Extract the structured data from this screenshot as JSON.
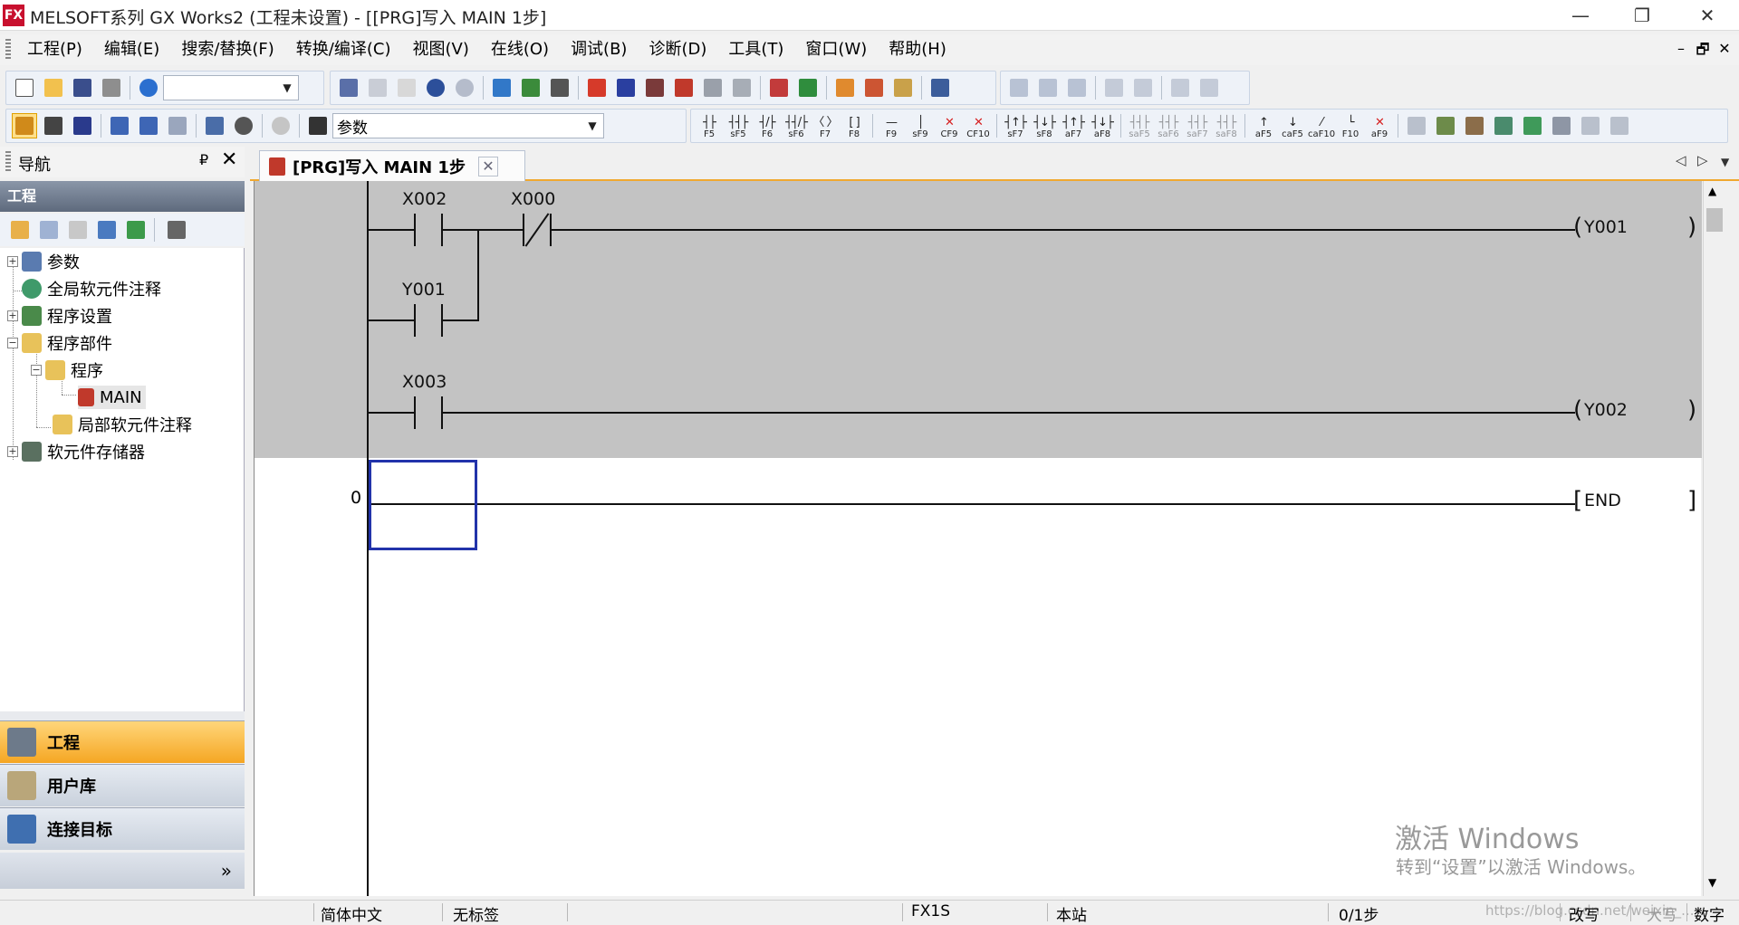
{
  "window": {
    "title": "MELSOFT系列 GX Works2 (工程未设置) - [[PRG]写入 MAIN 1步]",
    "app_icon_text": "FX",
    "controls": {
      "minimize": "—",
      "restore": "❐",
      "close": "✕"
    }
  },
  "menu": {
    "items": [
      "工程(P)",
      "编辑(E)",
      "搜索/替换(F)",
      "转换/编译(C)",
      "视图(V)",
      "在线(O)",
      "调试(B)",
      "诊断(D)",
      "工具(T)",
      "窗口(W)",
      "帮助(H)"
    ],
    "mdi_controls": {
      "minimize": "–",
      "restore": "🗗",
      "close": "✕"
    }
  },
  "toolbar": {
    "device_combo_value": "",
    "param_combo_value": "参数",
    "fkeys": [
      {
        "sym": "┤├",
        "label": "F5"
      },
      {
        "sym": "┤┤├",
        "label": "sF5"
      },
      {
        "sym": "┤/├",
        "label": "F6"
      },
      {
        "sym": "┤┤/├",
        "label": "sF6"
      },
      {
        "sym": "〈 〉",
        "label": "F7"
      },
      {
        "sym": "[ ]",
        "label": "F8"
      },
      {
        "sym": "—",
        "label": "F9"
      },
      {
        "sym": "│",
        "label": "sF9"
      },
      {
        "sym": "✕",
        "label": "CF9"
      },
      {
        "sym": "✕",
        "label": "CF10"
      },
      {
        "sym": "┤↑├",
        "label": "sF7"
      },
      {
        "sym": "┤↓├",
        "label": "sF8"
      },
      {
        "sym": "┤↑├",
        "label": "aF7"
      },
      {
        "sym": "┤↓├",
        "label": "aF8"
      },
      {
        "sym": "┤┤├",
        "label": "saF5"
      },
      {
        "sym": "┤┤├",
        "label": "saF6"
      },
      {
        "sym": "┤┤├",
        "label": "saF7"
      },
      {
        "sym": "┤┤├",
        "label": "saF8"
      },
      {
        "sym": "↑",
        "label": "aF5"
      },
      {
        "sym": "↓",
        "label": "caF5"
      },
      {
        "sym": "⁄",
        "label": "caF10"
      },
      {
        "sym": "└",
        "label": "F10"
      },
      {
        "sym": "✕",
        "label": "aF9"
      }
    ]
  },
  "nav": {
    "title": "导航",
    "pin": "₽",
    "close": "✕",
    "section": "工程",
    "tree": [
      {
        "label": "参数",
        "depth": 0,
        "expander": "+"
      },
      {
        "label": "全局软元件注释",
        "depth": 0,
        "expander": ""
      },
      {
        "label": "程序设置",
        "depth": 0,
        "expander": "+"
      },
      {
        "label": "程序部件",
        "depth": 0,
        "expander": "−"
      },
      {
        "label": "程序",
        "depth": 1,
        "expander": "−"
      },
      {
        "label": "MAIN",
        "depth": 2,
        "expander": ""
      },
      {
        "label": "局部软元件注释",
        "depth": 1,
        "expander": ""
      },
      {
        "label": "软元件存储器",
        "depth": 0,
        "expander": "+"
      }
    ],
    "bottom_buttons": [
      "工程",
      "用户库",
      "连接目标"
    ],
    "more": "»"
  },
  "editor": {
    "tab_label": "[PRG]写入 MAIN 1步",
    "tab_close": "✕",
    "tab_nav": {
      "prev": "◁",
      "next": "▷",
      "menu": "▼"
    },
    "ladder": {
      "contacts": [
        {
          "device": "X002",
          "type": "NO"
        },
        {
          "device": "X000",
          "type": "NC"
        },
        {
          "device": "Y001",
          "type": "NO"
        },
        {
          "device": "X003",
          "type": "NO"
        }
      ],
      "coils": [
        "Y001",
        "Y002"
      ],
      "end_instruction": "END",
      "step_number": "0"
    }
  },
  "watermark": {
    "title": "激活 Windows",
    "subtitle": "转到“设置”以激活 Windows。"
  },
  "status": {
    "language": "简体中文",
    "label": "无标签",
    "plc": "FX1S",
    "station": "本站",
    "steps": "0/1步",
    "mode": "改写",
    "caps": "大写",
    "num": "数字",
    "url": "https://blog.csdn.net/weixin_..."
  }
}
